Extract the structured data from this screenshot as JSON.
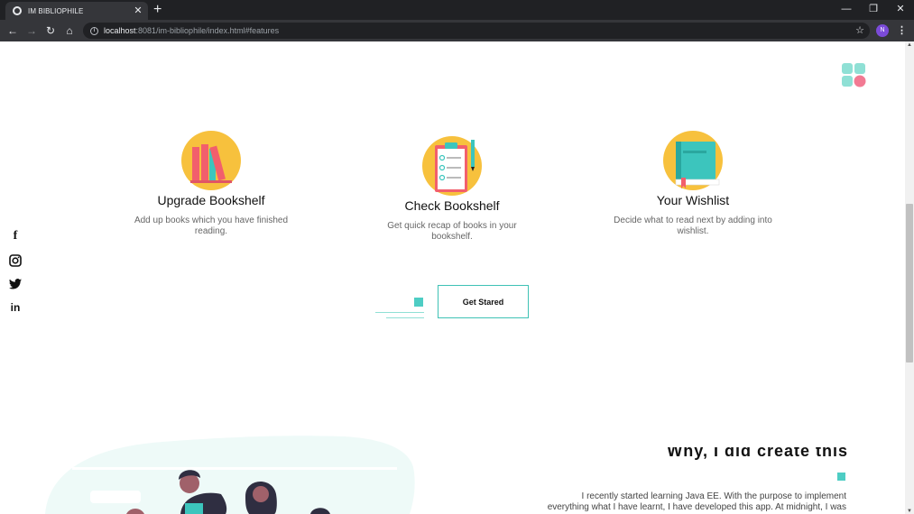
{
  "browser": {
    "tab_title": "IM BIBLIOPHILE",
    "tab_close": "✕",
    "new_tab": "+",
    "url_host": "localhost",
    "url_path": ":8081/im-bibliophile/index.html#features",
    "profile_initial": "N",
    "controls": {
      "minimize": "—",
      "restore": "❐",
      "close": "✕"
    },
    "nav": {
      "back": "←",
      "forward": "→",
      "reload": "↻",
      "home": "⌂"
    },
    "star": "☆",
    "menu": "⋮"
  },
  "features": [
    {
      "title": "Upgrade Bookshelf",
      "description": "Add up books which you have finished reading.",
      "icon": "bookshelf-icon"
    },
    {
      "title": "Check Bookshelf",
      "description": "Get quick recap of books in your bookshelf.",
      "icon": "clipboard-checklist-icon"
    },
    {
      "title": "Your Wishlist",
      "description": "Decide what to read next by adding into wishlist.",
      "icon": "book-icon"
    }
  ],
  "social": [
    {
      "name": "facebook-icon",
      "glyph": "f"
    },
    {
      "name": "instagram-icon",
      "glyph": "◎"
    },
    {
      "name": "twitter-icon",
      "glyph": "🐦"
    },
    {
      "name": "linkedin-icon",
      "glyph": "in"
    }
  ],
  "cta": {
    "label": "Get Stared"
  },
  "about": {
    "heading": "Why, I did create this",
    "text": "I recently started learning Java EE. With the purpose to implement everything what I have learnt, I have developed this app. At midnight, I was"
  },
  "colors": {
    "accent": "#4ecdc4",
    "icon_circle": "#f7c13d",
    "book_red": "#f25f6c",
    "book_teal": "#3cc5bd",
    "illustration_bg": "#eefaf8"
  }
}
